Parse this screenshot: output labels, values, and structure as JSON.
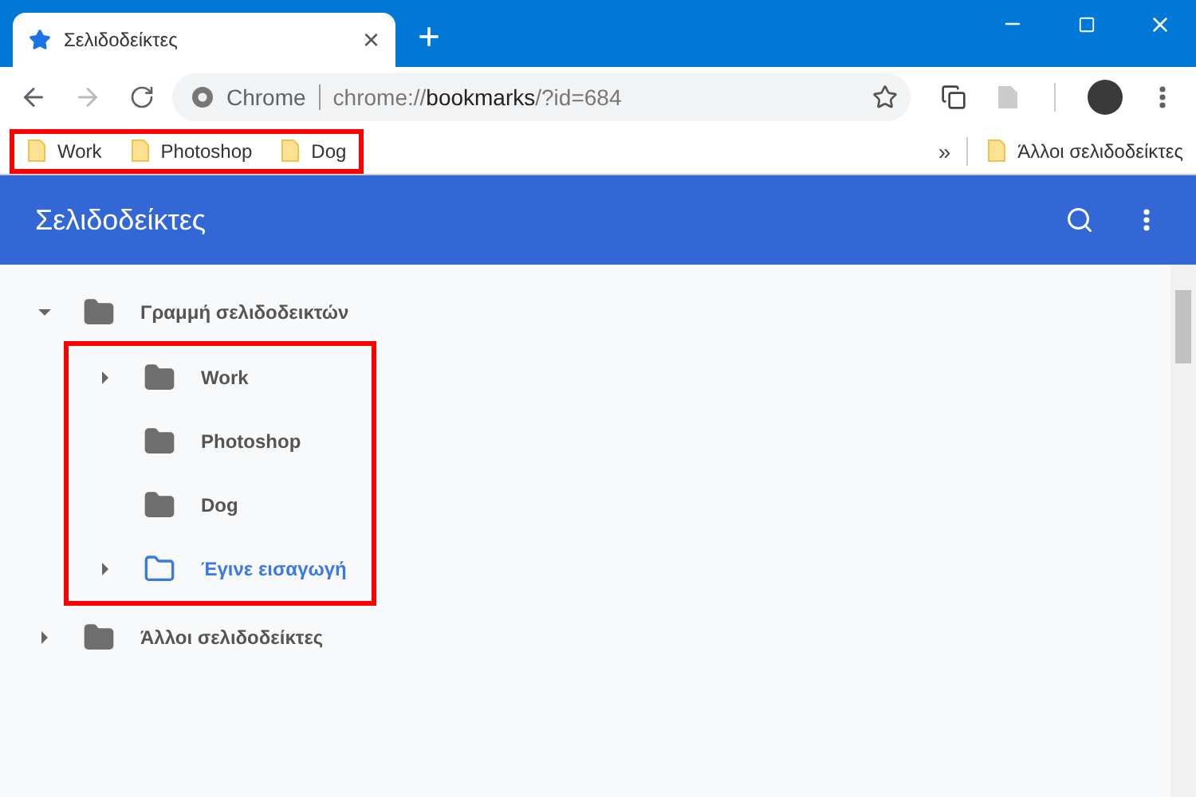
{
  "tab": {
    "title": "Σελιδοδείκτες",
    "close": "×",
    "selected": true
  },
  "new_tab": "+",
  "omnibox": {
    "site": "Chrome",
    "url_scheme": "chrome://",
    "url_host": "bookmarks",
    "url_path": "/?id=684"
  },
  "bookmark_bar": {
    "highlighted": true,
    "items": [
      {
        "label": "Work"
      },
      {
        "label": "Photoshop"
      },
      {
        "label": "Dog"
      }
    ],
    "overflow": "»",
    "other": "Άλλοι σελιδοδείκτες"
  },
  "app_bar": {
    "title": "Σελιδοδείκτες"
  },
  "tree": [
    {
      "label": "Γραμμή σελιδοδεικτών",
      "expandable": true,
      "expanded": true,
      "selected": false,
      "children_highlighted": true,
      "children": [
        {
          "label": "Work",
          "expandable": true,
          "expanded": false,
          "selected": false
        },
        {
          "label": "Photoshop",
          "expandable": false,
          "selected": false
        },
        {
          "label": "Dog",
          "expandable": false,
          "selected": false
        },
        {
          "label": "Έγινε εισαγωγή",
          "expandable": true,
          "expanded": false,
          "selected": true
        }
      ]
    },
    {
      "label": "Άλλοι σελιδοδείκτες",
      "expandable": true,
      "expanded": false,
      "selected": false
    }
  ]
}
